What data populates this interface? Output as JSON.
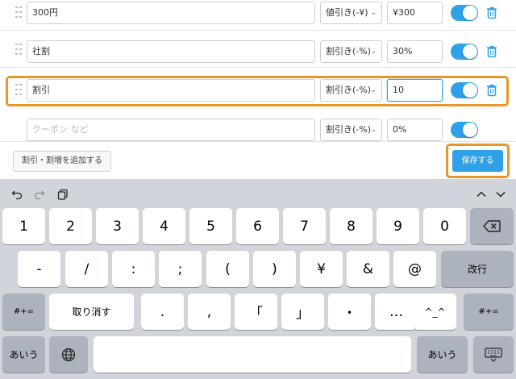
{
  "rows": [
    {
      "name": "300円",
      "name_is_placeholder": false,
      "kind": "値引き(-¥)",
      "value": "¥300",
      "enabled": true,
      "deletable": true
    },
    {
      "name": "社割",
      "name_is_placeholder": false,
      "kind": "割引き(-%)",
      "value": "30%",
      "enabled": true,
      "deletable": true
    },
    {
      "name": "割引",
      "name_is_placeholder": false,
      "kind": "割引き(-%)",
      "value": "10",
      "enabled": true,
      "deletable": true,
      "editing": true
    },
    {
      "name": "クーポン など",
      "name_is_placeholder": true,
      "kind": "割引き(-%)",
      "value": "0%",
      "enabled": true,
      "deletable": false
    }
  ],
  "actions": {
    "add_label": "割引・割増を追加する",
    "save_label": "保存する"
  },
  "colors": {
    "accent": "#2ea1e8",
    "highlight": "#e8962a",
    "keyboard_bg": "#d1d4da"
  },
  "keyboard": {
    "toolbar_icons": [
      "undo-icon",
      "redo-icon",
      "clipboard-icon",
      "chevron-up-icon",
      "chevron-down-icon"
    ],
    "row1": [
      "1",
      "2",
      "3",
      "4",
      "5",
      "6",
      "7",
      "8",
      "9",
      "0"
    ],
    "row2": [
      "-",
      "/",
      ":",
      ";",
      "(",
      ")",
      "¥",
      "&",
      "@"
    ],
    "return_label": "改行",
    "shift_label": "#+=",
    "undo_label": "取り消す",
    "row3": [
      ".",
      ",",
      "「",
      "」",
      "・",
      "…",
      "^_^"
    ],
    "kana_label": "あいう"
  }
}
